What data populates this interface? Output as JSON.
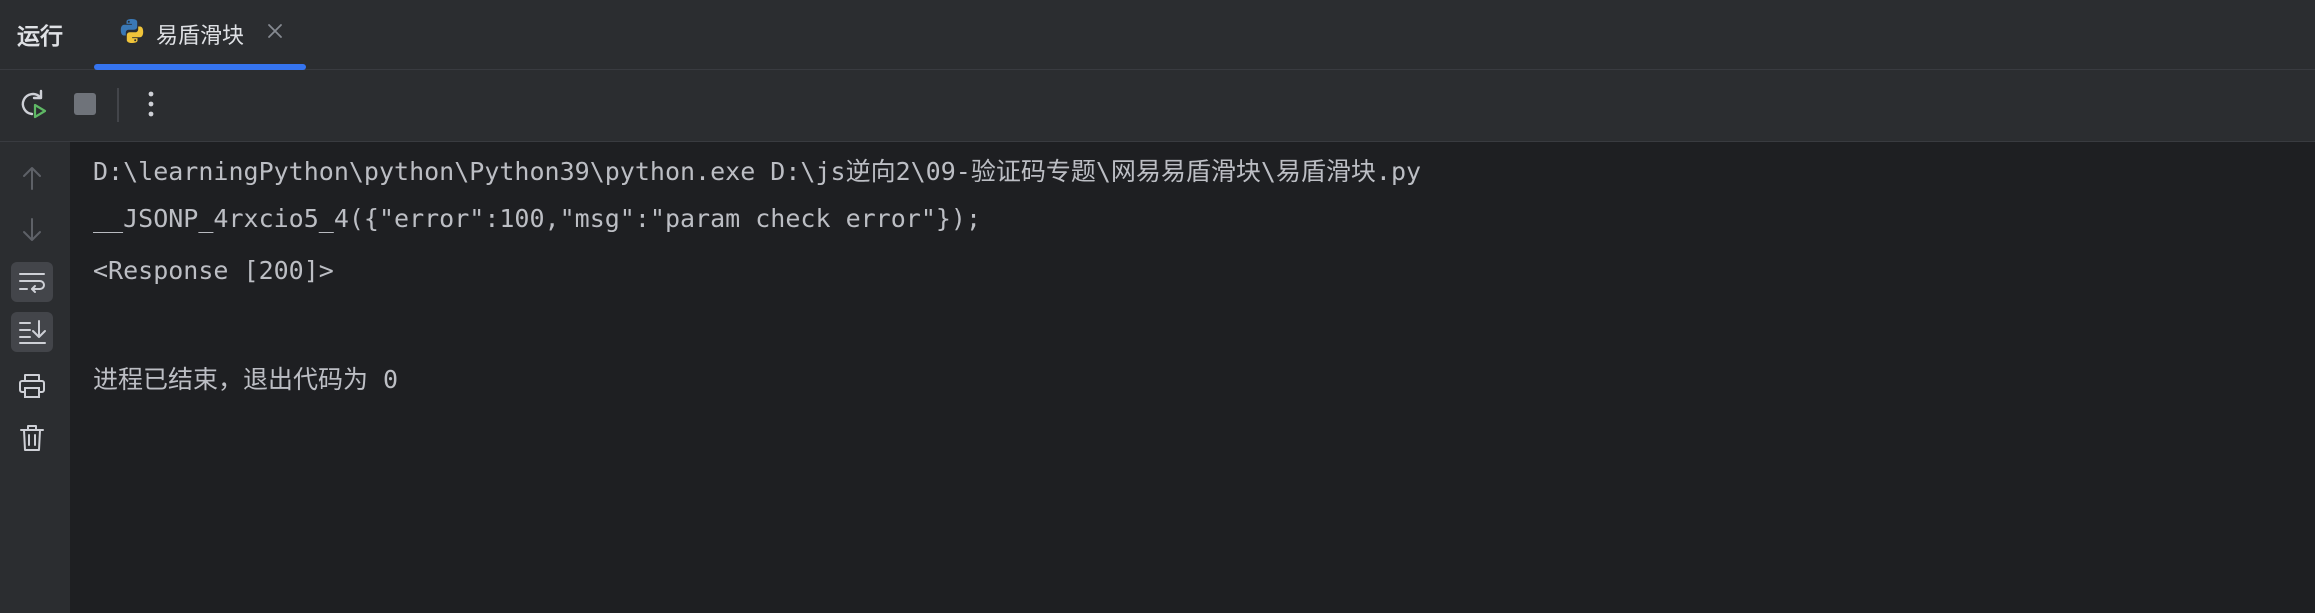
{
  "header": {
    "panel_title": "运行",
    "tab": {
      "label": "易盾滑块",
      "icon": "python-icon",
      "close_icon": "close-icon"
    }
  },
  "toolbar": {
    "buttons": [
      {
        "name": "rerun-button",
        "icon": "rerun-icon"
      },
      {
        "name": "stop-button",
        "icon": "stop-icon"
      },
      {
        "name": "more-options-button",
        "icon": "more-vertical-icon"
      }
    ]
  },
  "gutter": {
    "buttons": [
      {
        "name": "scroll-up-button",
        "icon": "arrow-up-icon",
        "active": false
      },
      {
        "name": "scroll-down-button",
        "icon": "arrow-down-icon",
        "active": false
      },
      {
        "name": "soft-wrap-button",
        "icon": "soft-wrap-icon",
        "active": true
      },
      {
        "name": "scroll-to-end-button",
        "icon": "scroll-to-end-icon",
        "active": true
      },
      {
        "name": "print-button",
        "icon": "print-icon",
        "active": false
      },
      {
        "name": "clear-all-button",
        "icon": "trash-icon",
        "active": false
      }
    ]
  },
  "console": {
    "lines": [
      "D:\\learningPython\\python\\Python39\\python.exe D:\\js逆向2\\09-验证码专题\\网易易盾滑块\\易盾滑块.py",
      "__JSONP_4rxcio5_4({\"error\":100,\"msg\":\"param check error\"});",
      "<Response [200]>",
      "",
      "进程已结束，退出代码为 0"
    ]
  },
  "colors": {
    "background": "#1e1f22",
    "panel": "#2b2d30",
    "accent": "#3574f0",
    "text": "#bcbec4",
    "run_green": "#5fb865"
  }
}
